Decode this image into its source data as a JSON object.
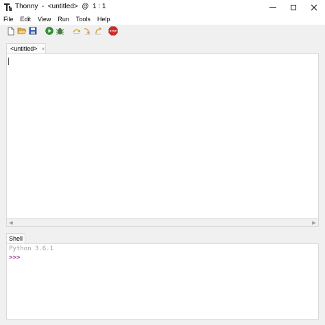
{
  "window": {
    "title": "Thonny  -  <untitled>  @  1 : 1",
    "minimize_glyph": "—",
    "maximize_glyph": "☐",
    "close_glyph": "✕"
  },
  "menu": [
    "File",
    "Edit",
    "View",
    "Run",
    "Tools",
    "Help"
  ],
  "toolbar": {
    "icons": [
      "new-file-icon",
      "open-file-icon",
      "save-icon",
      "run-icon",
      "debug-icon",
      "step-over-icon",
      "step-into-icon",
      "step-out-icon",
      "stop-icon"
    ],
    "stop_text": "STOP"
  },
  "editor": {
    "tab_label": "<untitled>",
    "tab_close": "×"
  },
  "shell": {
    "tab_label": "Shell",
    "version_line": "Python 3.6.1",
    "prompt": ">>>"
  },
  "colors": {
    "prompt": "#9b2f8a",
    "run_green": "#2f9a2f",
    "stop_red": "#d22a2a"
  }
}
